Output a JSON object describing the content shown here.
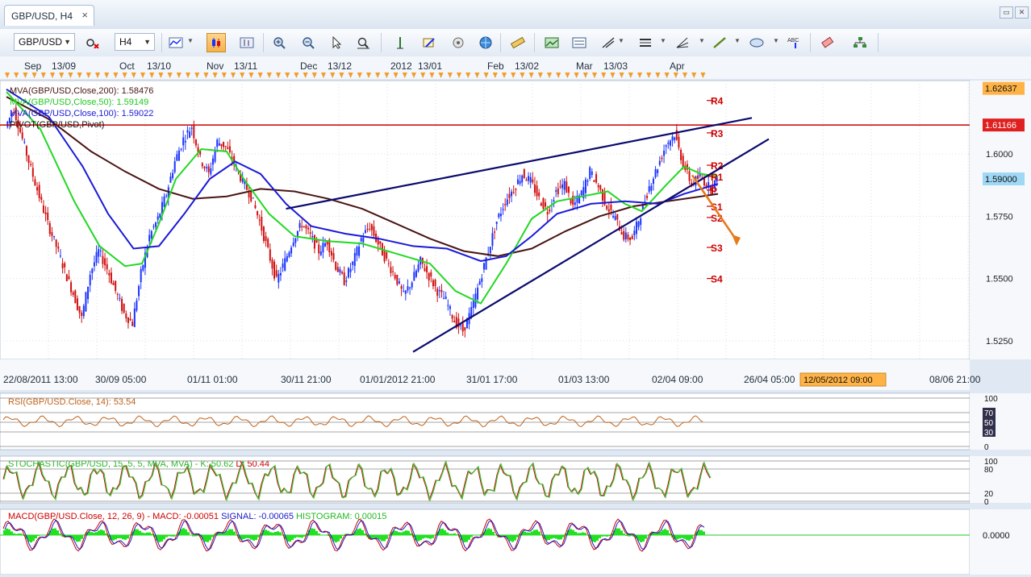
{
  "window": {
    "tab_title": "GBP/USD, H4",
    "close_glyph": "×",
    "restore_glyph": "▭",
    "close_window_glyph": "✕"
  },
  "toolbar": {
    "symbol": "GBP/USD",
    "timeframe": "H4",
    "icons": [
      "chart-settings-icon",
      "indicator-remove-icon",
      "chart-type-icon",
      "candle-chart-icon",
      "bar-chart-icon",
      "zoom-in-icon",
      "zoom-out-icon",
      "cursor-icon",
      "zoom-select-icon",
      "vertical-line-icon",
      "alarm-icon",
      "properties-icon",
      "globe-icon",
      "ruler-icon",
      "snapshot-icon",
      "template-icon",
      "trend-tools-icon",
      "channel-icon",
      "fib-tools-icon",
      "line-draw-icon",
      "shape-icon",
      "text-label-icon",
      "eraser-icon",
      "object-list-icon"
    ]
  },
  "colors": {
    "up": "#1a33ff",
    "down": "#d01010",
    "ma200": "#4a1414",
    "ma50": "#22d822",
    "ma100": "#1a1ad8",
    "pivot": "#cc0000",
    "trend": "#0b0b6e",
    "arrow": "#e87a1a",
    "rsi": "#c0621a",
    "stoch": "#38c838",
    "macd": "#cc0000",
    "signal": "#1a1ac8",
    "histogram": "#22e022",
    "price_label_bg": "#ffb347",
    "current_price_bg": "#9fd8f5"
  },
  "chart_data": {
    "type": "candlestick",
    "symbol": "GBP/USD",
    "timeframe": "H4",
    "title": "GBP/USD, H4",
    "ylim": [
      1.5175,
      1.6295
    ],
    "y_ticks": [
      "1.5250",
      "1.5500",
      "1.5750",
      "1.6000"
    ],
    "y_tick_values": [
      1.525,
      1.55,
      1.575,
      1.6
    ],
    "price_labels": [
      {
        "text": "1.62637",
        "value": 1.62637,
        "type": "window-high"
      },
      {
        "text": "1.61166",
        "value": 1.61166,
        "type": "pivot-resistance"
      },
      {
        "text": "1.59000",
        "value": 1.59,
        "type": "current"
      }
    ],
    "top_period_labels": [
      {
        "month": "Sep",
        "week": "13/09"
      },
      {
        "month": "Oct",
        "week": "13/10"
      },
      {
        "month": "Nov",
        "week": "13/11"
      },
      {
        "month": "Dec",
        "week": "13/12"
      },
      {
        "month": "2012",
        "week": "13/01"
      },
      {
        "month": "Feb",
        "week": "13/02"
      },
      {
        "month": "Mar",
        "week": "13/03"
      },
      {
        "month": "Apr",
        "week": ""
      }
    ],
    "x_ticks": [
      "22/08/2011 13:00",
      "30/09 05:00",
      "01/11 01:00",
      "30/11 21:00",
      "01/01/2012 21:00",
      "31/01 17:00",
      "01/03 13:00",
      "02/04 09:00",
      "26/04 05:00",
      "08/06 21:00"
    ],
    "x_cursor_label": "12/05/2012 09:00",
    "price_path": [
      [
        0,
        1.611
      ],
      [
        1,
        1.618
      ],
      [
        2,
        1.606
      ],
      [
        3,
        1.594
      ],
      [
        4,
        1.583
      ],
      [
        5,
        1.572
      ],
      [
        6,
        1.563
      ],
      [
        7,
        1.553
      ],
      [
        8,
        1.544
      ],
      [
        9,
        1.534
      ],
      [
        10,
        1.552
      ],
      [
        11,
        1.561
      ],
      [
        12,
        1.554
      ],
      [
        13,
        1.545
      ],
      [
        14,
        1.536
      ],
      [
        15,
        1.532
      ],
      [
        16,
        1.552
      ],
      [
        17,
        1.567
      ],
      [
        18,
        1.574
      ],
      [
        19,
        1.584
      ],
      [
        20,
        1.597
      ],
      [
        21,
        1.606
      ],
      [
        22,
        1.611
      ],
      [
        23,
        1.598
      ],
      [
        24,
        1.592
      ],
      [
        25,
        1.605
      ],
      [
        26,
        1.603
      ],
      [
        27,
        1.596
      ],
      [
        28,
        1.589
      ],
      [
        29,
        1.583
      ],
      [
        30,
        1.573
      ],
      [
        31,
        1.561
      ],
      [
        32,
        1.549
      ],
      [
        33,
        1.557
      ],
      [
        34,
        1.566
      ],
      [
        35,
        1.572
      ],
      [
        36,
        1.567
      ],
      [
        37,
        1.561
      ],
      [
        38,
        1.565
      ],
      [
        39,
        1.555
      ],
      [
        40,
        1.549
      ],
      [
        41,
        1.556
      ],
      [
        42,
        1.566
      ],
      [
        43,
        1.571
      ],
      [
        44,
        1.564
      ],
      [
        45,
        1.557
      ],
      [
        46,
        1.551
      ],
      [
        47,
        1.543
      ],
      [
        48,
        1.549
      ],
      [
        49,
        1.557
      ],
      [
        50,
        1.551
      ],
      [
        51,
        1.545
      ],
      [
        52,
        1.541
      ],
      [
        53,
        1.533
      ],
      [
        54,
        1.529
      ],
      [
        55,
        1.537
      ],
      [
        56,
        1.549
      ],
      [
        57,
        1.561
      ],
      [
        58,
        1.573
      ],
      [
        59,
        1.581
      ],
      [
        60,
        1.586
      ],
      [
        61,
        1.592
      ],
      [
        62,
        1.589
      ],
      [
        63,
        1.582
      ],
      [
        64,
        1.577
      ],
      [
        65,
        1.585
      ],
      [
        66,
        1.588
      ],
      [
        67,
        1.579
      ],
      [
        68,
        1.584
      ],
      [
        69,
        1.593
      ],
      [
        70,
        1.587
      ],
      [
        71,
        1.579
      ],
      [
        72,
        1.574
      ],
      [
        73,
        1.567
      ],
      [
        74,
        1.566
      ],
      [
        75,
        1.576
      ],
      [
        76,
        1.587
      ],
      [
        77,
        1.595
      ],
      [
        78,
        1.604
      ],
      [
        79,
        1.608
      ],
      [
        80,
        1.596
      ],
      [
        81,
        1.588
      ],
      [
        82,
        1.591
      ],
      [
        83,
        1.587
      ],
      [
        84,
        1.589
      ]
    ],
    "moving_averages": [
      {
        "name": "MVA(GBP/USD,Close,200)",
        "value_text": "1.58476",
        "path": [
          [
            0,
            1.623
          ],
          [
            5,
            1.614
          ],
          [
            10,
            1.601
          ],
          [
            14,
            1.593
          ],
          [
            18,
            1.586
          ],
          [
            22,
            1.582
          ],
          [
            26,
            1.583
          ],
          [
            30,
            1.586
          ],
          [
            34,
            1.585
          ],
          [
            38,
            1.582
          ],
          [
            42,
            1.578
          ],
          [
            46,
            1.572
          ],
          [
            50,
            1.566
          ],
          [
            54,
            1.561
          ],
          [
            58,
            1.559
          ],
          [
            62,
            1.562
          ],
          [
            66,
            1.569
          ],
          [
            70,
            1.575
          ],
          [
            74,
            1.579
          ],
          [
            78,
            1.581
          ],
          [
            82,
            1.583
          ],
          [
            84,
            1.584
          ]
        ]
      },
      {
        "name": "MVA(GBP/USD,Close,50)",
        "value_text": "1.59149",
        "path": [
          [
            0,
            1.625
          ],
          [
            4,
            1.61
          ],
          [
            8,
            1.581
          ],
          [
            11,
            1.563
          ],
          [
            14,
            1.555
          ],
          [
            16,
            1.556
          ],
          [
            18,
            1.572
          ],
          [
            20,
            1.59
          ],
          [
            23,
            1.602
          ],
          [
            26,
            1.601
          ],
          [
            28,
            1.59
          ],
          [
            31,
            1.576
          ],
          [
            34,
            1.567
          ],
          [
            38,
            1.565
          ],
          [
            42,
            1.564
          ],
          [
            46,
            1.56
          ],
          [
            50,
            1.556
          ],
          [
            53,
            1.545
          ],
          [
            56,
            1.54
          ],
          [
            59,
            1.556
          ],
          [
            62,
            1.574
          ],
          [
            65,
            1.581
          ],
          [
            68,
            1.583
          ],
          [
            71,
            1.585
          ],
          [
            73,
            1.58
          ],
          [
            75,
            1.577
          ],
          [
            78,
            1.588
          ],
          [
            80,
            1.595
          ],
          [
            82,
            1.592
          ],
          [
            84,
            1.591
          ]
        ]
      },
      {
        "name": "MVA(GBP/USD,Close,100)",
        "value_text": "1.59022",
        "path": [
          [
            0,
            1.626
          ],
          [
            5,
            1.615
          ],
          [
            9,
            1.595
          ],
          [
            12,
            1.576
          ],
          [
            15,
            1.562
          ],
          [
            18,
            1.563
          ],
          [
            21,
            1.576
          ],
          [
            24,
            1.59
          ],
          [
            27,
            1.597
          ],
          [
            30,
            1.592
          ],
          [
            33,
            1.58
          ],
          [
            36,
            1.571
          ],
          [
            40,
            1.568
          ],
          [
            44,
            1.566
          ],
          [
            48,
            1.563
          ],
          [
            52,
            1.562
          ],
          [
            56,
            1.557
          ],
          [
            59,
            1.559
          ],
          [
            62,
            1.567
          ],
          [
            65,
            1.576
          ],
          [
            69,
            1.58
          ],
          [
            73,
            1.581
          ],
          [
            77,
            1.58
          ],
          [
            80,
            1.584
          ],
          [
            84,
            1.588
          ]
        ]
      }
    ],
    "pivot": {
      "label": "PIVOT(GBP/USD,Pivot)",
      "levels": [
        {
          "name": "R4",
          "value": 1.6215
        },
        {
          "name": "R3",
          "value": 1.6085
        },
        {
          "name": "R2",
          "value": 1.5955
        },
        {
          "name": "R1",
          "value": 1.591
        },
        {
          "name": "P",
          "value": 1.5855
        },
        {
          "name": "S1",
          "value": 1.579
        },
        {
          "name": "S2",
          "value": 1.5745
        },
        {
          "name": "S3",
          "value": 1.5625
        },
        {
          "name": "S4",
          "value": 1.55
        }
      ]
    },
    "resistance_line": 1.61166,
    "trendlines": [
      {
        "from": [
          33,
          1.578
        ],
        "to": [
          88,
          1.6145
        ]
      },
      {
        "from": [
          48,
          1.5205
        ],
        "to": [
          90,
          1.606
        ]
      }
    ],
    "forecast_arrow": {
      "from": [
        80,
        1.5915
      ],
      "to": [
        84,
        1.5755
      ]
    },
    "panels": [
      {
        "name": "rsi",
        "label": "RSI(GBP/USD.Close, 14): 53.54",
        "scale": [
          "100",
          "70",
          "50",
          "30",
          "0"
        ],
        "levels": [
          100,
          70,
          50,
          30,
          0
        ]
      },
      {
        "name": "stochastic",
        "label": "STOCHASTIC(GBP/USD, 15, 5, 5, MVA, MVA) - K: 50.62",
        "label2": "D: 50.44",
        "scale": [
          "100",
          "80",
          "20",
          "0"
        ],
        "levels": [
          100,
          80,
          20,
          0
        ]
      },
      {
        "name": "macd",
        "label": "MACD(GBP/USD.Close, 12, 26, 9) - MACD: -0.00051",
        "label2": "SIGNAL: -0.00065",
        "label3": "HISTOGRAM: 0.00015",
        "scale": [
          "0.0000"
        ]
      }
    ]
  }
}
